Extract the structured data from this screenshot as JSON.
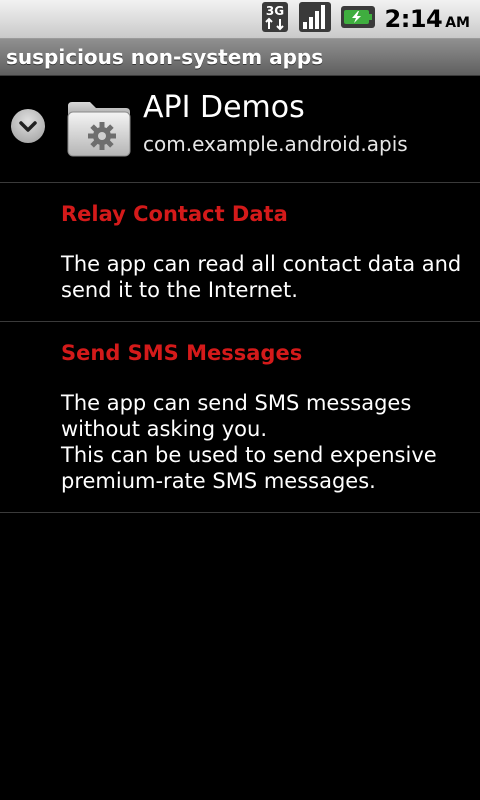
{
  "status_bar": {
    "network_icon": "3g-data-icon",
    "signal_icon": "signal-strength-icon",
    "battery_icon": "battery-charging-icon",
    "time": "2:14",
    "ampm": "AM"
  },
  "title_bar": {
    "title": "suspicious non-system apps"
  },
  "app": {
    "name": "API Demos",
    "package": "com.example.android.apis",
    "expand_icon": "chevron-down-icon",
    "app_icon": "folder-gear-icon"
  },
  "permissions": [
    {
      "title": "Relay Contact Data",
      "description": "The app can read all contact data and send it to the Internet."
    },
    {
      "title": "Send SMS Messages",
      "description": "The app can send SMS messages without asking you.\nThis can be used to send expensive premium-rate SMS messages."
    }
  ],
  "colors": {
    "permission_title": "#d41a1a",
    "background": "#000000",
    "title_bar": "#7a7a7a"
  }
}
